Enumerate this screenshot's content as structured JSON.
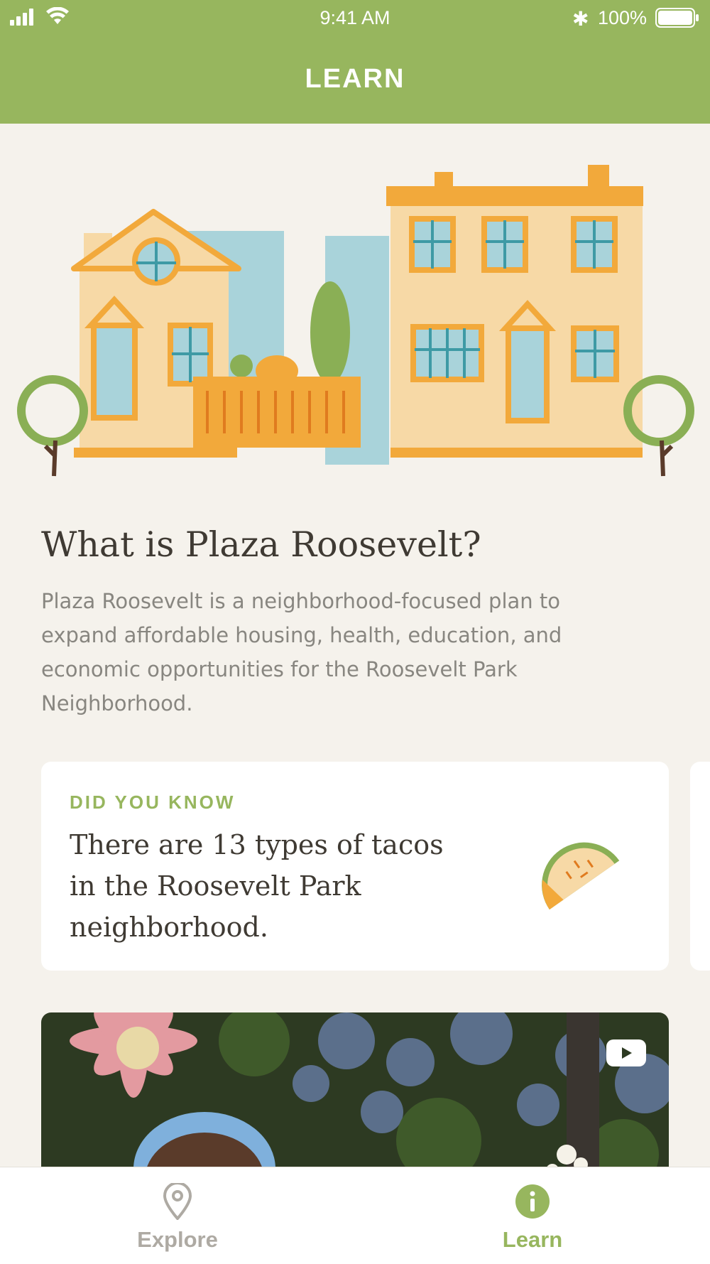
{
  "status_bar": {
    "time": "9:41 AM",
    "battery_percent": "100%",
    "battery_level": 1.0
  },
  "header": {
    "title": "LEARN"
  },
  "intro": {
    "title": "What is Plaza Roosevelt?",
    "body": "Plaza Roosevelt is a neighborhood-focused plan to expand affordable housing, health, education, and economic opportunities for the Roosevelt Park Neighborhood."
  },
  "fact_card": {
    "eyebrow": "DID YOU KNOW",
    "text": "There are 13 types of tacos in the Roosevelt Park neighborhood.",
    "icon": "taco-icon"
  },
  "video_card": {
    "icon": "youtube-play-icon"
  },
  "tabbar": {
    "tabs": [
      {
        "label": "Explore",
        "icon": "map-pin-icon",
        "active": false
      },
      {
        "label": "Learn",
        "icon": "info-icon",
        "active": true
      }
    ]
  },
  "colors": {
    "accent_green": "#97b65e",
    "background": "#f5f2ec",
    "title_text": "#3f3a33",
    "body_text": "#888680",
    "inactive_tab": "#aeaaa3"
  }
}
